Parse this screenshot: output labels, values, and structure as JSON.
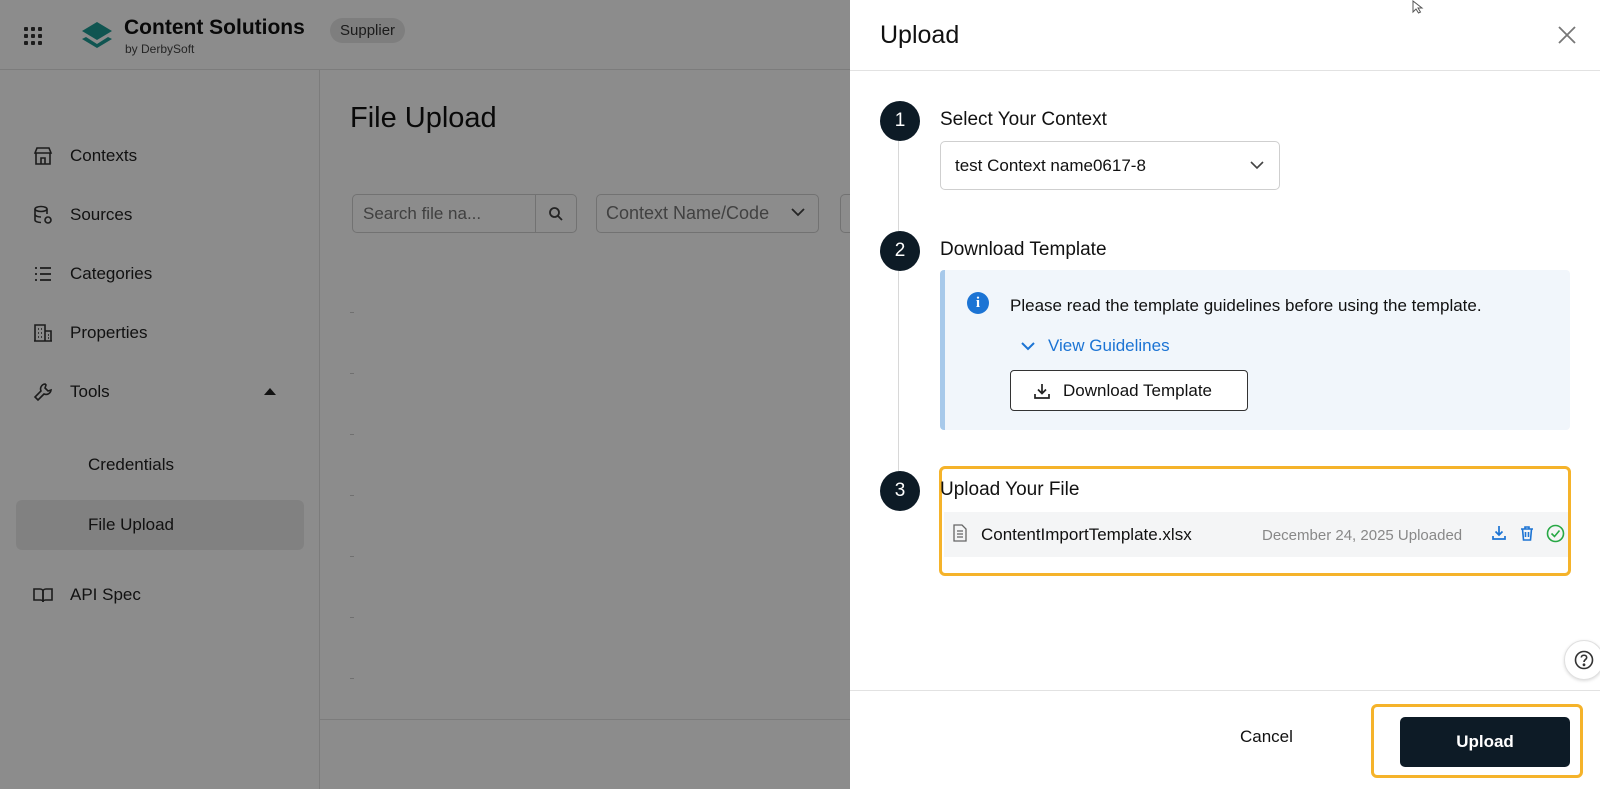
{
  "app": {
    "brand_name": "Content Solutions",
    "brand_sub": "by DerbySoft",
    "role_badge": "Supplier",
    "logo_color": "#1e9c94"
  },
  "sidebar": {
    "items": [
      {
        "label": "Contexts",
        "icon": "storefront-icon"
      },
      {
        "label": "Sources",
        "icon": "database-gear-icon"
      },
      {
        "label": "Categories",
        "icon": "list-icon"
      },
      {
        "label": "Properties",
        "icon": "building-icon"
      },
      {
        "label": "Tools",
        "icon": "wrench-icon",
        "expanded": true
      },
      {
        "label": "Credentials"
      },
      {
        "label": "File Upload",
        "active": true
      },
      {
        "label": "API Spec",
        "icon": "book-icon"
      }
    ]
  },
  "main": {
    "page_title": "File Upload",
    "search_placeholder": "Search file na...",
    "context_filter": "Context Name/Code"
  },
  "drawer": {
    "title": "Upload",
    "steps": [
      {
        "number": "1",
        "title": "Select Your Context"
      },
      {
        "number": "2",
        "title": "Download Template"
      },
      {
        "number": "3",
        "title": "Upload Your File"
      }
    ],
    "context_value": "test Context name0617-8",
    "info_text": "Please read the template guidelines before using the template.",
    "view_guidelines": "View Guidelines",
    "download_template": "Download Template",
    "file": {
      "name": "ContentImportTemplate.xlsx",
      "meta": "December 24, 2025 Uploaded",
      "status": "uploaded"
    },
    "cancel_label": "Cancel",
    "upload_label": "Upload"
  },
  "colors": {
    "primary_dark": "#0d1b26",
    "link_blue": "#1c74d4",
    "highlight": "#f5b32a",
    "success": "#27a844"
  }
}
